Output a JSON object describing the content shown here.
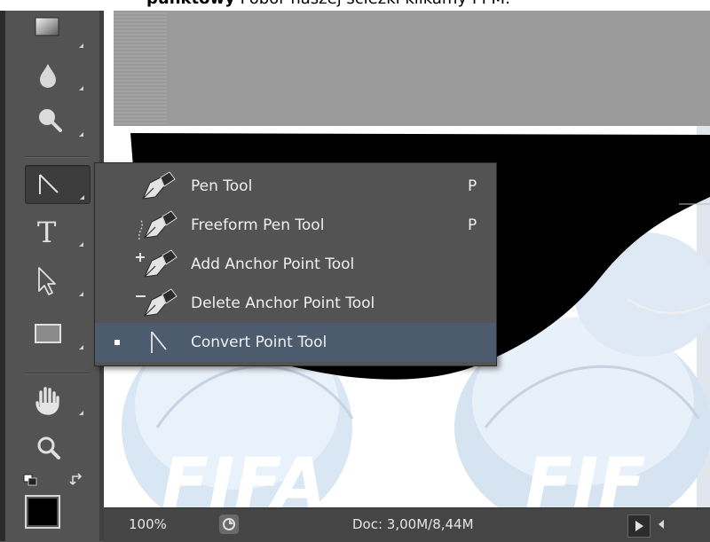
{
  "caption": {
    "bold_text": "punktowy",
    "rest_text": "Pobór naszej ścieżki klikamy PPM."
  },
  "toolbar": {
    "tools": [
      {
        "name": "gradient-tool",
        "icon": "gradient-icon"
      },
      {
        "name": "blur-tool",
        "icon": "drop-icon"
      },
      {
        "name": "dodge-tool",
        "icon": "dodge-icon"
      },
      {
        "name": "convert-point-tool",
        "icon": "convert-point-icon",
        "selected": true
      },
      {
        "name": "type-tool",
        "icon": "type-icon"
      },
      {
        "name": "path-selection-tool",
        "icon": "direct-selection-arrow-icon"
      },
      {
        "name": "rectangle-tool",
        "icon": "rectangle-icon"
      },
      {
        "name": "hand-tool",
        "icon": "hand-icon"
      },
      {
        "name": "zoom-tool",
        "icon": "magnifier-icon"
      }
    ],
    "type_glyph": "T",
    "foreground_color": "#000000",
    "background_color": "#ffffff"
  },
  "menu": {
    "items": [
      {
        "label": "Pen Tool",
        "shortcut": "P",
        "icon": "pen-icon",
        "active": false
      },
      {
        "label": "Freeform Pen Tool",
        "shortcut": "P",
        "icon": "freeform-pen-icon",
        "active": false
      },
      {
        "label": "Add Anchor Point Tool",
        "shortcut": "",
        "icon": "add-anchor-icon",
        "active": false
      },
      {
        "label": "Delete Anchor Point Tool",
        "shortcut": "",
        "icon": "delete-anchor-icon",
        "active": false
      },
      {
        "label": "Convert Point Tool",
        "shortcut": "",
        "icon": "convert-point-icon",
        "active": true
      }
    ],
    "highlight_color": "#4c5b6d"
  },
  "canvas": {
    "watermark_text": "FIFA",
    "watermark_text_2": "FIF"
  },
  "statusbar": {
    "zoom": "100%",
    "doc_info": "Doc: 3,00M/8,44M"
  }
}
